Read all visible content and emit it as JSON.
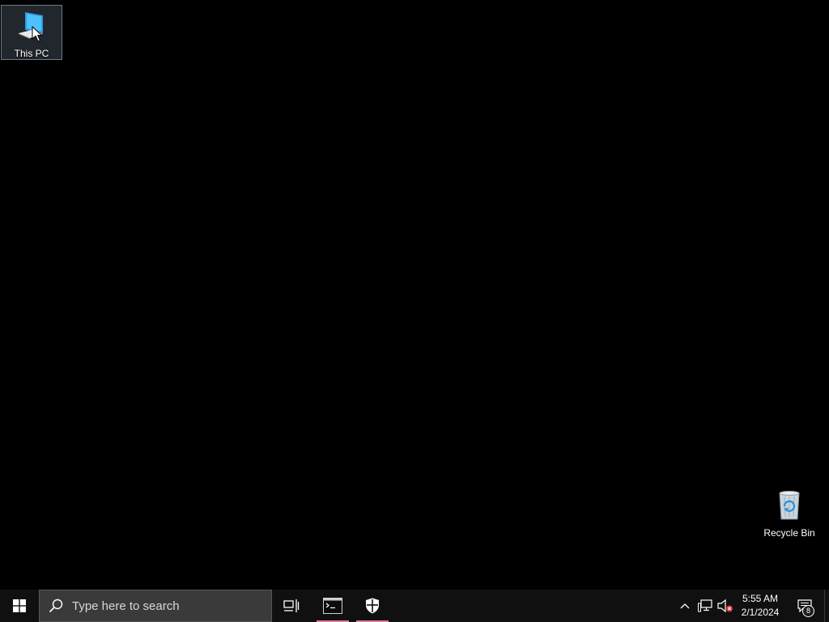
{
  "desktop": {
    "background_color": "#000000",
    "icons": [
      {
        "label": "This PC",
        "icon": "this-pc-icon",
        "selected": true
      },
      {
        "label": "Recycle Bin",
        "icon": "recycle-bin-icon",
        "selected": false
      }
    ]
  },
  "taskbar": {
    "start_icon": "windows-logo-icon",
    "search": {
      "placeholder": "Type here to search",
      "icon": "search-icon"
    },
    "task_view_icon": "task-view-icon",
    "pinned_apps": [
      {
        "icon": "command-prompt-icon",
        "running": true
      },
      {
        "icon": "windows-security-shield-icon",
        "running": true
      }
    ],
    "running_indicator_color": "#e07a9a",
    "tray": {
      "overflow_icon": "chevron-up-icon",
      "network_icon": "network-icon",
      "volume_icon": "volume-muted-icon",
      "time": "5:55 AM",
      "date": "2/1/2024",
      "notifications_icon": "action-center-icon",
      "notification_count": "8"
    }
  }
}
